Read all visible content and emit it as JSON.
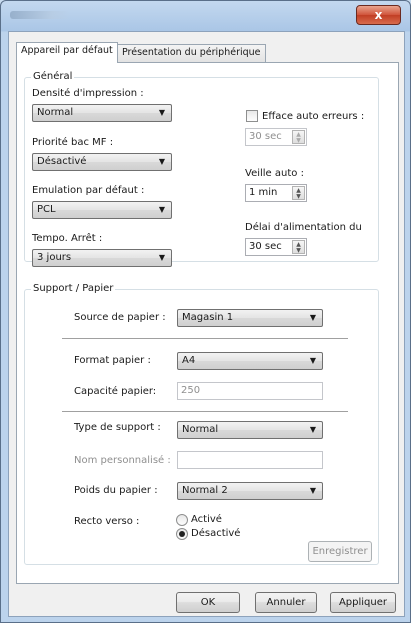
{
  "window": {
    "close_glyph": "x"
  },
  "tabs": [
    {
      "label": "Appareil par défaut"
    },
    {
      "label": "Présentation du périphérique"
    }
  ],
  "general": {
    "title": "Général",
    "density": {
      "label": "Densité d'impression :",
      "value": "Normal"
    },
    "priority": {
      "label": "Priorité bac MF :",
      "value": "Désactivé"
    },
    "emulation": {
      "label": "Emulation par défaut :",
      "value": "PCL"
    },
    "timer": {
      "label": "Tempo. Arrêt :",
      "value": "3 jours"
    },
    "auto_error": {
      "label": "Efface auto erreurs :",
      "checked": false,
      "value": "30 sec"
    },
    "sleep": {
      "label": "Veille auto :",
      "value": "1 min"
    },
    "feed_delay": {
      "label": "Délai d'alimentation du",
      "value": "30 sec"
    }
  },
  "support": {
    "title": "Support / Papier",
    "source": {
      "label": "Source de papier :",
      "value": "Magasin 1"
    },
    "format": {
      "label": "Format papier :",
      "value": "A4"
    },
    "capacity": {
      "label": "Capacité papier:",
      "value": "250"
    },
    "media_type": {
      "label": "Type de support :",
      "value": "Normal"
    },
    "custom_name": {
      "label": "Nom personnalisé :",
      "value": ""
    },
    "weight": {
      "label": "Poids du papier :",
      "value": "Normal 2"
    },
    "duplex": {
      "label": "Recto verso :",
      "options": [
        "Activé",
        "Désactivé"
      ],
      "selected": "Désactivé"
    },
    "save_label": "Enregistrer"
  },
  "footer": {
    "ok": "OK",
    "cancel": "Annuler",
    "apply": "Appliquer"
  }
}
